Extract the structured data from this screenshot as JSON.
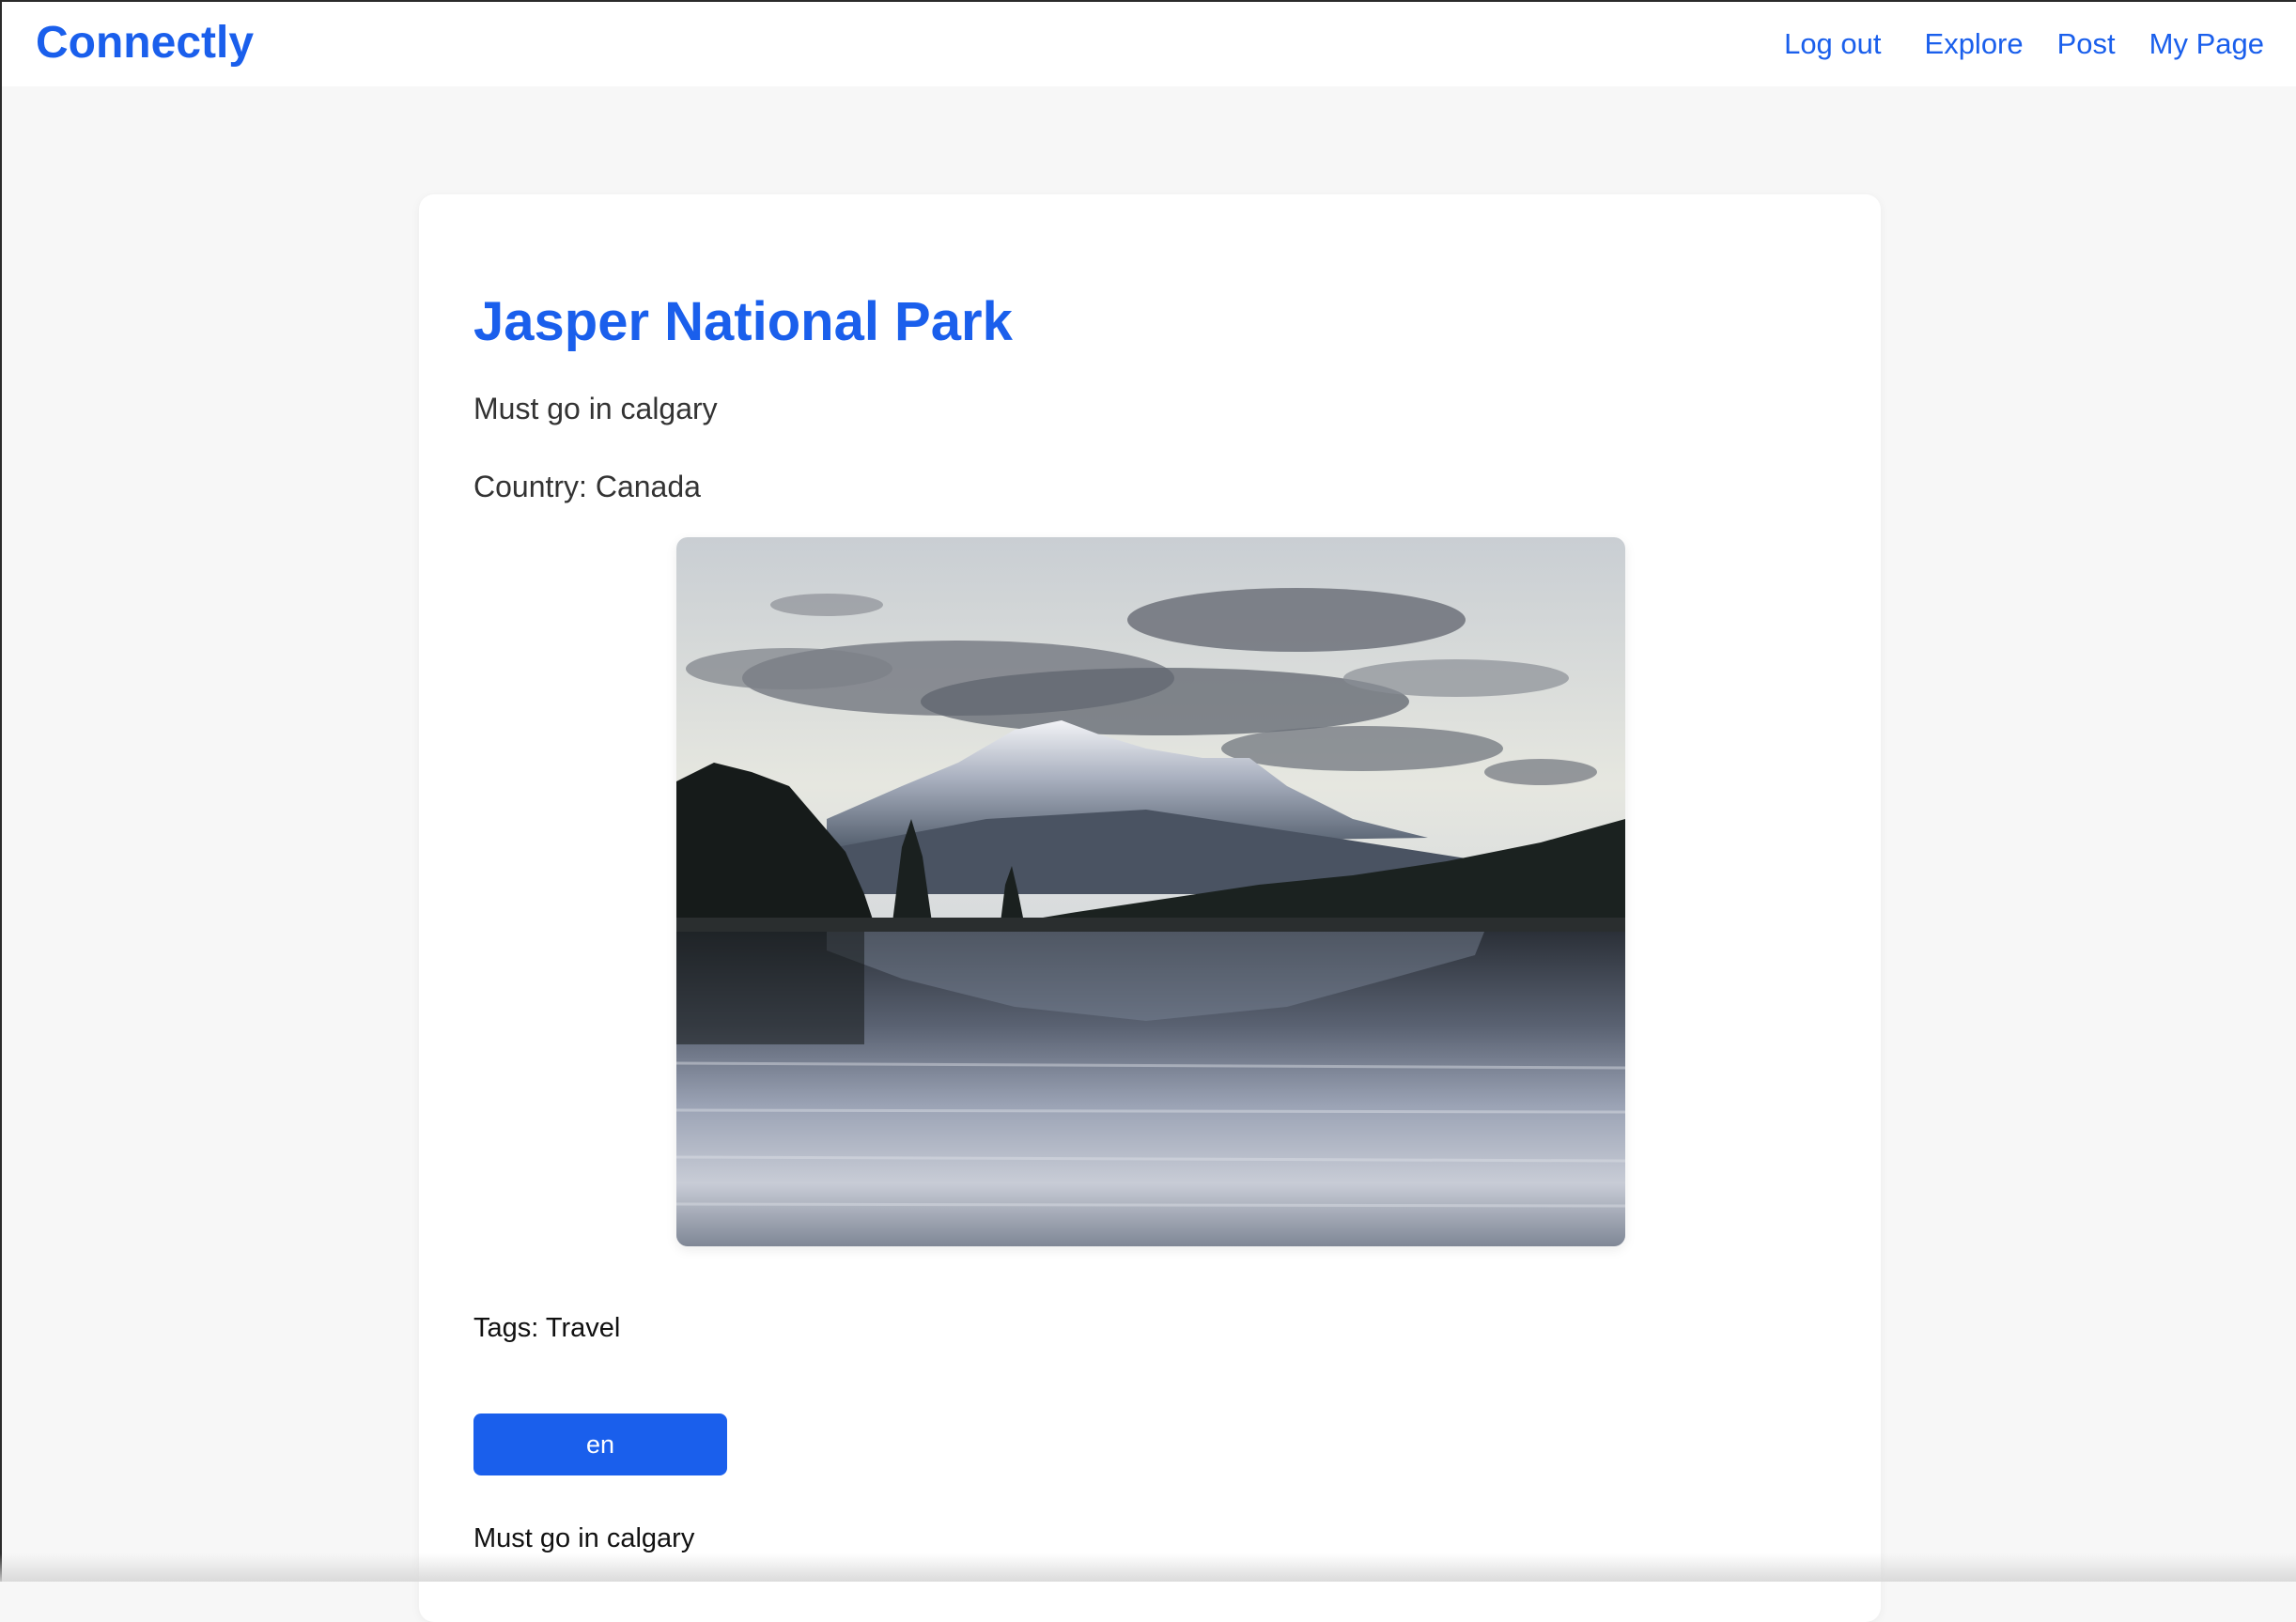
{
  "header": {
    "brand": "Connectly",
    "nav": {
      "logout": "Log out",
      "explore": "Explore",
      "post": "Post",
      "my_page": "My Page"
    }
  },
  "post": {
    "title": "Jasper National Park",
    "description": "Must go in calgary",
    "country": "Country: Canada",
    "image_alt": "Mountain lake with snow-capped peak and forest reflection",
    "tags": "Tags: Travel",
    "language_button": "en",
    "translated_description": "Must go in calgary"
  },
  "colors": {
    "accent": "#1a5fec",
    "background": "#f7f7f7",
    "card": "#ffffff"
  }
}
